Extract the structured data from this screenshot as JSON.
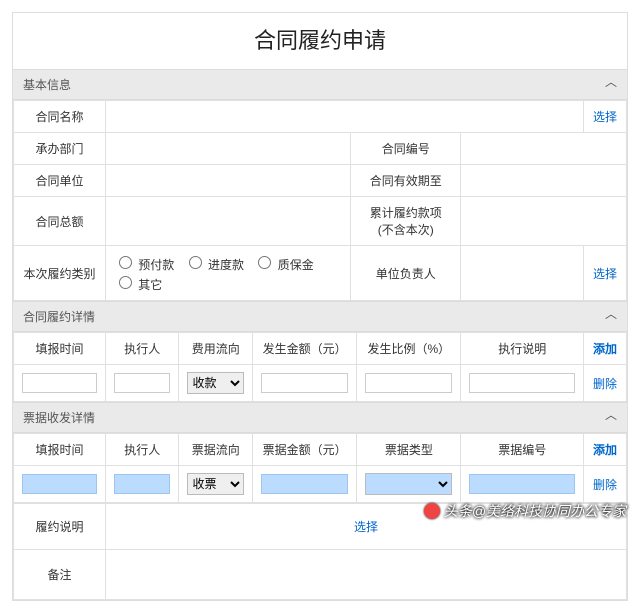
{
  "title": "合同履约申请",
  "section1": {
    "header": "基本信息",
    "rows": {
      "contract_name": "合同名称",
      "select1": "选择",
      "dept": "承办部门",
      "contract_no": "合同编号",
      "unit": "合同单位",
      "valid_until": "合同有效期至",
      "total": "合同总额",
      "cumulative": "累计履约款项\n(不含本次)",
      "type_label": "本次履约类别",
      "r1": "预付款",
      "r2": "进度款",
      "r3": "质保金",
      "r4": "其它",
      "unit_head": "单位负责人",
      "select2": "选择"
    }
  },
  "section2": {
    "header": "合同履约详情",
    "cols": {
      "c1": "填报时间",
      "c2": "执行人",
      "c3": "费用流向",
      "c4": "发生金额（元）",
      "c5": "发生比例（%）",
      "c6": "执行说明",
      "add": "添加",
      "del": "删除"
    },
    "row1": {
      "flow": "收款"
    }
  },
  "section3": {
    "header": "票据收发详情",
    "cols": {
      "c1": "填报时间",
      "c2": "执行人",
      "c3": "票据流向",
      "c4": "票据金额（元）",
      "c5": "票据类型",
      "c6": "票据编号",
      "add": "添加",
      "del": "删除"
    },
    "row1": {
      "flow": "收票"
    }
  },
  "footer": {
    "desc_label": "履约说明",
    "select3": "选择",
    "remark": "备注"
  },
  "watermark": "头条@美络科技协同办公专家"
}
